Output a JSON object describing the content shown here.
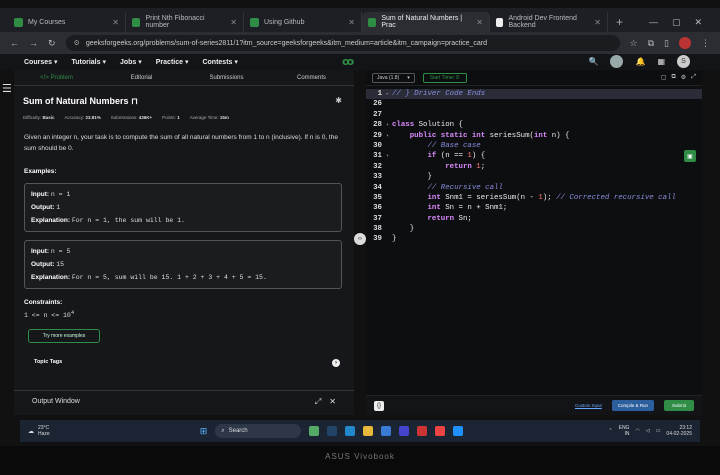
{
  "browser": {
    "tabs": [
      {
        "title": "My Courses",
        "color": "#2f8d46",
        "active": false
      },
      {
        "title": "Print Nth Fibonacci number",
        "color": "#2f8d46",
        "active": false
      },
      {
        "title": "Using Github",
        "color": "#2f8d46",
        "active": false
      },
      {
        "title": "Sum of Natural Numbers | Prac",
        "color": "#2f8d46",
        "active": true
      },
      {
        "title": "Android Dev Frontend Backend",
        "color": "#eeeeee",
        "active": false
      }
    ],
    "new_tab": "+",
    "url": "geeksforgeeks.org/problems/sum-of-series2811/1?itm_source=geeksforgeeks&itm_medium=article&itm_campaign=practice_card"
  },
  "site_nav": {
    "items": [
      "Courses ▾",
      "Tutorials ▾",
      "Jobs ▾",
      "Practice ▾",
      "Contests ▾"
    ],
    "avatar_letter": "S"
  },
  "problem": {
    "tabs": [
      "</> Problem",
      "Editorial",
      "Submissions",
      "Comments"
    ],
    "title": "Sum of Natural Numbers",
    "meta": [
      {
        "label": "Difficulty:",
        "value": "Basic"
      },
      {
        "label": "Accuracy:",
        "value": "23.81%"
      },
      {
        "label": "Submissions:",
        "value": "436K+"
      },
      {
        "label": "Points:",
        "value": "1"
      },
      {
        "label": "Average Time:",
        "value": "15m"
      }
    ],
    "description": "Given an integer n, your task is to compute the sum of all natural numbers from 1 to n (inclusive). If n is 0, the sum should be 0.",
    "examples_heading": "Examples:",
    "examples": [
      {
        "input": "n = 1",
        "output": "1",
        "explanation": "For n = 1, the sum will be 1."
      },
      {
        "input": "n = 5",
        "output": "15",
        "explanation": "For n = 5, sum will be 15. 1 + 2 + 3 + 4 + 5 = 15."
      }
    ],
    "input_label": "Input:",
    "output_label": "Output:",
    "explanation_label": "Explanation:",
    "constraints_heading": "Constraints:",
    "constraint": "1 <= n <= 10",
    "constraint_exp": "4",
    "more_examples": "Try more examples",
    "topic_tags": "Topic Tags",
    "output_window": "Output Window"
  },
  "editor": {
    "language": "Java (1.8)",
    "timer": "Start Timer ⏱",
    "lines": [
      {
        "n": "1",
        "fold": "▸",
        "html": "<span class='cm'>// } Driver Code Ends</span>",
        "hl": true
      },
      {
        "n": "26",
        "fold": "",
        "html": "",
        "hl": false
      },
      {
        "n": "27",
        "fold": "",
        "html": "",
        "hl": false
      },
      {
        "n": "28",
        "fold": "▾",
        "html": "<span class='kw'>class</span> Solution {",
        "hl": false
      },
      {
        "n": "29",
        "fold": "▾",
        "html": "    <span class='kw'>public static</span> <span class='ty'>int</span> seriesSum(<span class='ty'>int</span> n) {",
        "hl": false
      },
      {
        "n": "30",
        "fold": "",
        "html": "        <span class='cm'>// Base case</span>",
        "hl": false
      },
      {
        "n": "31",
        "fold": "▾",
        "html": "        <span class='kw'>if</span> (n == <span class='nm'>1</span>) {",
        "hl": false
      },
      {
        "n": "32",
        "fold": "",
        "html": "            <span class='kw'>return</span> <span class='nm'>1</span>;",
        "hl": false
      },
      {
        "n": "33",
        "fold": "",
        "html": "        }",
        "hl": false
      },
      {
        "n": "34",
        "fold": "",
        "html": "        <span class='cm'>// Recursive call</span>",
        "hl": false
      },
      {
        "n": "35",
        "fold": "",
        "html": "        <span class='ty'>int</span> Snm1 = seriesSum(n - <span class='nm'>1</span>); <span class='cm'>// Corrected recursive call</span>",
        "hl": false
      },
      {
        "n": "36",
        "fold": "",
        "html": "        <span class='ty'>int</span> Sn = n + Snm1;",
        "hl": false
      },
      {
        "n": "37",
        "fold": "",
        "html": "        <span class='kw'>return</span> Sn;",
        "hl": false
      },
      {
        "n": "38",
        "fold": "",
        "html": "    }",
        "hl": false
      },
      {
        "n": "39",
        "fold": "",
        "html": "}",
        "hl": false
      }
    ],
    "custom_input": "Custom Input",
    "compile_run": "Compile & Run",
    "submit": "Submit"
  },
  "taskbar": {
    "temp": "23°C",
    "weather": "Haze",
    "search": "Search",
    "lang": "ENG",
    "region": "IN",
    "time": "23:12",
    "date": "04-02-2025"
  },
  "laptop_brand": "ASUS Vivobook"
}
